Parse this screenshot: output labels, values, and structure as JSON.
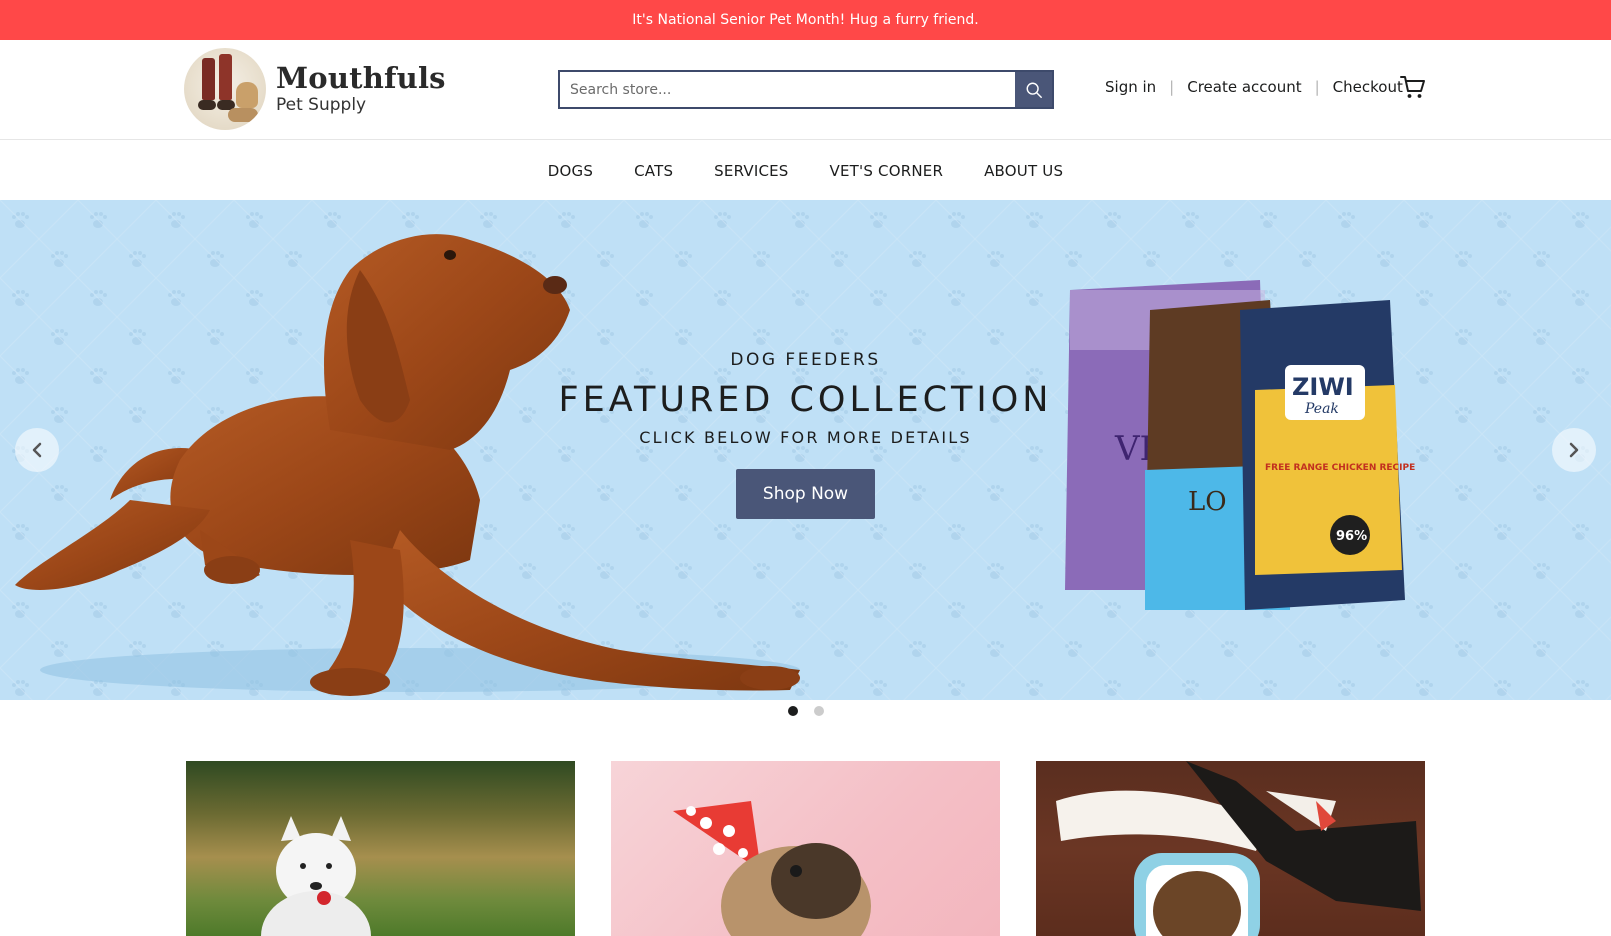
{
  "announcement": {
    "text": "It's National Senior Pet Month! Hug a furry friend."
  },
  "header": {
    "logo_title": "Mouthfuls",
    "logo_subtitle": "Pet Supply",
    "search": {
      "placeholder": "Search store..."
    },
    "account_links": {
      "sign_in": "Sign in",
      "create_account": "Create account",
      "checkout": "Checkout"
    }
  },
  "nav": {
    "items": [
      {
        "label": "DOGS"
      },
      {
        "label": "CATS"
      },
      {
        "label": "SERVICES"
      },
      {
        "label": "VET'S CORNER"
      },
      {
        "label": "ABOUT US"
      }
    ]
  },
  "hero": {
    "subtitle": "DOG FEEDERS",
    "title": "FEATURED COLLECTION",
    "cta_text": "CLICK BELOW FOR MORE DETAILS",
    "button_label": "Shop Now",
    "bag_labels": {
      "bag1": "VE",
      "bag2": "LO",
      "bag3_brand": "ZIWI",
      "bag3_line": "Peak",
      "bag3_recipe": "FREE RANGE CHICKEN RECIPE",
      "bag3_badge": "96%"
    },
    "slides": {
      "count": 2,
      "active": 1
    }
  },
  "colors": {
    "announcement_bg": "#ff4848",
    "accent": "#4a5678",
    "hero_bg": "#bfe0f6"
  },
  "icons": [
    "search-icon",
    "cart-icon",
    "chevron-left-icon",
    "chevron-right-icon"
  ]
}
